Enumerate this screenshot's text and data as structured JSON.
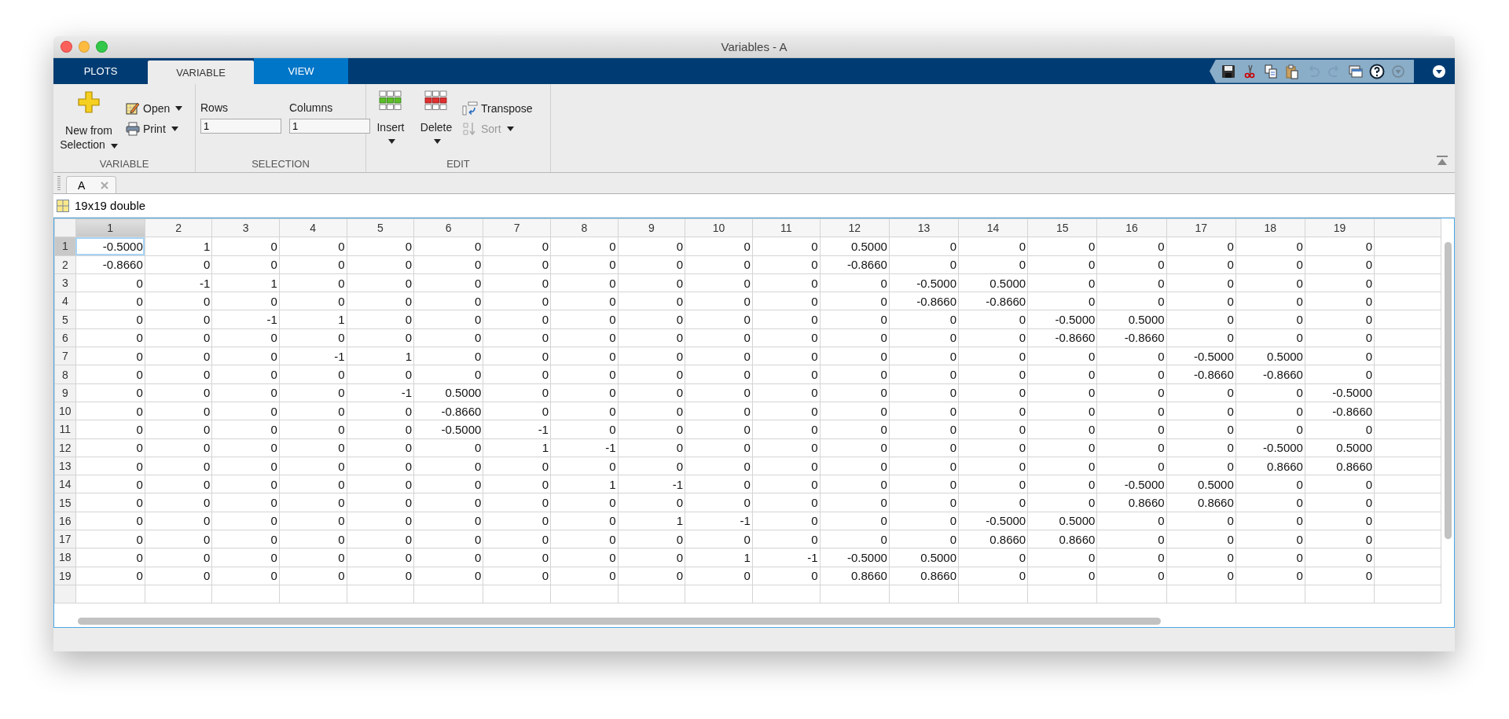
{
  "window": {
    "title": "Variables - A"
  },
  "ribbon_tabs": [
    {
      "label": "PLOTS",
      "selected": false
    },
    {
      "label": "VARIABLE",
      "selected": true
    },
    {
      "label": "VIEW",
      "selected": false
    }
  ],
  "quick_access": [
    {
      "kind": "save",
      "disabled": false
    },
    {
      "kind": "cut",
      "disabled": false
    },
    {
      "kind": "copy",
      "disabled": false
    },
    {
      "kind": "paste",
      "disabled": false
    },
    {
      "kind": "undo",
      "disabled": true
    },
    {
      "kind": "redo",
      "disabled": true
    },
    {
      "kind": "window",
      "disabled": false
    },
    {
      "kind": "help",
      "disabled": false
    },
    {
      "kind": "more",
      "disabled": true
    }
  ],
  "ribbon": {
    "variable_group": {
      "label": "VARIABLE",
      "new_from_selection": "New from Selection",
      "open": "Open",
      "print": "Print"
    },
    "selection_group": {
      "label": "SELECTION",
      "rows_label": "Rows",
      "rows_value": "1",
      "columns_label": "Columns",
      "columns_value": "1"
    },
    "edit_group": {
      "label": "EDIT",
      "insert": "Insert",
      "delete": "Delete",
      "transpose": {
        "label": "Transpose",
        "disabled": false
      },
      "sort": {
        "label": "Sort",
        "disabled": true
      }
    }
  },
  "document_tabs": [
    {
      "label": "A",
      "selected": true
    }
  ],
  "variable_info": "19x19 double",
  "table": {
    "columns": [
      {
        "label": "1",
        "selected": true
      },
      {
        "label": "2",
        "selected": false
      },
      {
        "label": "3",
        "selected": false
      },
      {
        "label": "4",
        "selected": false
      },
      {
        "label": "5",
        "selected": false
      },
      {
        "label": "6",
        "selected": false
      },
      {
        "label": "7",
        "selected": false
      },
      {
        "label": "8",
        "selected": false
      },
      {
        "label": "9",
        "selected": false
      },
      {
        "label": "10",
        "selected": false
      },
      {
        "label": "11",
        "selected": false
      },
      {
        "label": "12",
        "selected": false
      },
      {
        "label": "13",
        "selected": false
      },
      {
        "label": "14",
        "selected": false
      },
      {
        "label": "15",
        "selected": false
      },
      {
        "label": "16",
        "selected": false
      },
      {
        "label": "17",
        "selected": false
      },
      {
        "label": "18",
        "selected": false
      },
      {
        "label": "19",
        "selected": false
      }
    ],
    "rows": [
      {
        "label": "1",
        "selected": true,
        "cells": [
          "-0.5000",
          "1",
          "0",
          "0",
          "0",
          "0",
          "0",
          "0",
          "0",
          "0",
          "0",
          "0.5000",
          "0",
          "0",
          "0",
          "0",
          "0",
          "0",
          "0"
        ]
      },
      {
        "label": "2",
        "selected": false,
        "cells": [
          "-0.8660",
          "0",
          "0",
          "0",
          "0",
          "0",
          "0",
          "0",
          "0",
          "0",
          "0",
          "-0.8660",
          "0",
          "0",
          "0",
          "0",
          "0",
          "0",
          "0"
        ]
      },
      {
        "label": "3",
        "selected": false,
        "cells": [
          "0",
          "-1",
          "1",
          "0",
          "0",
          "0",
          "0",
          "0",
          "0",
          "0",
          "0",
          "0",
          "-0.5000",
          "0.5000",
          "0",
          "0",
          "0",
          "0",
          "0"
        ]
      },
      {
        "label": "4",
        "selected": false,
        "cells": [
          "0",
          "0",
          "0",
          "0",
          "0",
          "0",
          "0",
          "0",
          "0",
          "0",
          "0",
          "0",
          "-0.8660",
          "-0.8660",
          "0",
          "0",
          "0",
          "0",
          "0"
        ]
      },
      {
        "label": "5",
        "selected": false,
        "cells": [
          "0",
          "0",
          "-1",
          "1",
          "0",
          "0",
          "0",
          "0",
          "0",
          "0",
          "0",
          "0",
          "0",
          "0",
          "-0.5000",
          "0.5000",
          "0",
          "0",
          "0"
        ]
      },
      {
        "label": "6",
        "selected": false,
        "cells": [
          "0",
          "0",
          "0",
          "0",
          "0",
          "0",
          "0",
          "0",
          "0",
          "0",
          "0",
          "0",
          "0",
          "0",
          "-0.8660",
          "-0.8660",
          "0",
          "0",
          "0"
        ]
      },
      {
        "label": "7",
        "selected": false,
        "cells": [
          "0",
          "0",
          "0",
          "-1",
          "1",
          "0",
          "0",
          "0",
          "0",
          "0",
          "0",
          "0",
          "0",
          "0",
          "0",
          "0",
          "-0.5000",
          "0.5000",
          "0"
        ]
      },
      {
        "label": "8",
        "selected": false,
        "cells": [
          "0",
          "0",
          "0",
          "0",
          "0",
          "0",
          "0",
          "0",
          "0",
          "0",
          "0",
          "0",
          "0",
          "0",
          "0",
          "0",
          "-0.8660",
          "-0.8660",
          "0"
        ]
      },
      {
        "label": "9",
        "selected": false,
        "cells": [
          "0",
          "0",
          "0",
          "0",
          "-1",
          "0.5000",
          "0",
          "0",
          "0",
          "0",
          "0",
          "0",
          "0",
          "0",
          "0",
          "0",
          "0",
          "0",
          "-0.5000"
        ]
      },
      {
        "label": "10",
        "selected": false,
        "cells": [
          "0",
          "0",
          "0",
          "0",
          "0",
          "-0.8660",
          "0",
          "0",
          "0",
          "0",
          "0",
          "0",
          "0",
          "0",
          "0",
          "0",
          "0",
          "0",
          "-0.8660"
        ]
      },
      {
        "label": "11",
        "selected": false,
        "cells": [
          "0",
          "0",
          "0",
          "0",
          "0",
          "-0.5000",
          "-1",
          "0",
          "0",
          "0",
          "0",
          "0",
          "0",
          "0",
          "0",
          "0",
          "0",
          "0",
          "0"
        ]
      },
      {
        "label": "12",
        "selected": false,
        "cells": [
          "0",
          "0",
          "0",
          "0",
          "0",
          "0",
          "1",
          "-1",
          "0",
          "0",
          "0",
          "0",
          "0",
          "0",
          "0",
          "0",
          "0",
          "-0.5000",
          "0.5000"
        ]
      },
      {
        "label": "13",
        "selected": false,
        "cells": [
          "0",
          "0",
          "0",
          "0",
          "0",
          "0",
          "0",
          "0",
          "0",
          "0",
          "0",
          "0",
          "0",
          "0",
          "0",
          "0",
          "0",
          "0.8660",
          "0.8660"
        ]
      },
      {
        "label": "14",
        "selected": false,
        "cells": [
          "0",
          "0",
          "0",
          "0",
          "0",
          "0",
          "0",
          "1",
          "-1",
          "0",
          "0",
          "0",
          "0",
          "0",
          "0",
          "-0.5000",
          "0.5000",
          "0",
          "0"
        ]
      },
      {
        "label": "15",
        "selected": false,
        "cells": [
          "0",
          "0",
          "0",
          "0",
          "0",
          "0",
          "0",
          "0",
          "0",
          "0",
          "0",
          "0",
          "0",
          "0",
          "0",
          "0.8660",
          "0.8660",
          "0",
          "0"
        ]
      },
      {
        "label": "16",
        "selected": false,
        "cells": [
          "0",
          "0",
          "0",
          "0",
          "0",
          "0",
          "0",
          "0",
          "1",
          "-1",
          "0",
          "0",
          "0",
          "-0.5000",
          "0.5000",
          "0",
          "0",
          "0",
          "0"
        ]
      },
      {
        "label": "17",
        "selected": false,
        "cells": [
          "0",
          "0",
          "0",
          "0",
          "0",
          "0",
          "0",
          "0",
          "0",
          "0",
          "0",
          "0",
          "0",
          "0.8660",
          "0.8660",
          "0",
          "0",
          "0",
          "0"
        ]
      },
      {
        "label": "18",
        "selected": false,
        "cells": [
          "0",
          "0",
          "0",
          "0",
          "0",
          "0",
          "0",
          "0",
          "0",
          "1",
          "-1",
          "-0.5000",
          "0.5000",
          "0",
          "0",
          "0",
          "0",
          "0",
          "0"
        ]
      },
      {
        "label": "19",
        "selected": false,
        "cells": [
          "0",
          "0",
          "0",
          "0",
          "0",
          "0",
          "0",
          "0",
          "0",
          "0",
          "0",
          "0.8660",
          "0.8660",
          "0",
          "0",
          "0",
          "0",
          "0",
          "0"
        ]
      }
    ]
  }
}
